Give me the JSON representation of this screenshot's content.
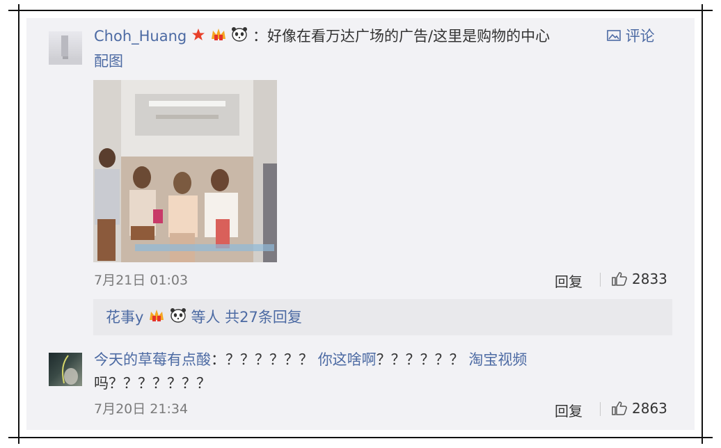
{
  "comments": [
    {
      "username": "Choh_Huang",
      "badges": [
        "star-icon",
        "crown-badge-icon",
        "panda-icon"
      ],
      "separator": "：",
      "text": "好像在看万达广场的广告/这里是购物的中心",
      "pic_link_label": "评论",
      "pic_link_label2": "配图",
      "time": "7月21日 01:03",
      "reply_label": "回复",
      "like_count": "2833",
      "replies_summary": {
        "user": "花事y",
        "badges": [
          "crown-badge-icon",
          "panda-icon"
        ],
        "text": "等人 共27条回复"
      }
    },
    {
      "username": "今天的草莓有点酸",
      "separator": "：",
      "text_part1": "？？？？？？",
      "link_text": "你这啥啊",
      "text_part2": "？？？？？？",
      "link_text2": "淘宝视频",
      "text_line2": "吗？？？？？？？",
      "time": "7月20日 21:34",
      "reply_label": "回复",
      "like_count": "2863"
    }
  ],
  "colors": {
    "link": "#4c6aa3",
    "panel": "#f2f2f5",
    "reply_bar": "#e9e9ec"
  }
}
